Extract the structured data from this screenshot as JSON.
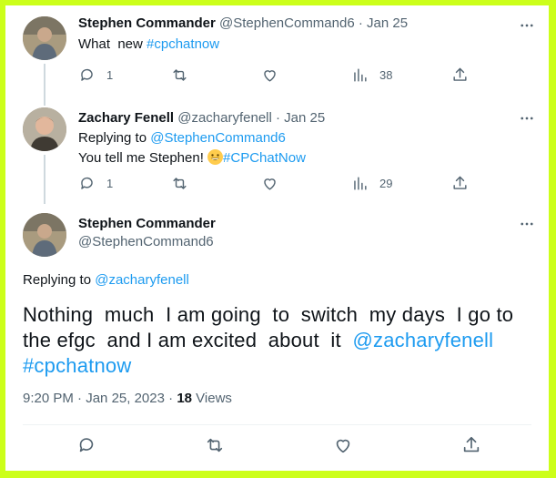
{
  "tweets": [
    {
      "display_name": "Stephen Commander",
      "handle": "@StephenCommand6",
      "date": "Jan 25",
      "text_plain": "What  new ",
      "hashtag": "#cpchatnow",
      "replies": "1",
      "views": "38"
    },
    {
      "display_name": "Zachary Fenell",
      "handle": "@zacharyfenell",
      "date": "Jan 25",
      "replying_label": "Replying to ",
      "replying_to": "@StephenCommand6",
      "text_plain": "You tell me Stephen! ",
      "hashtag": "#CPChatNow",
      "replies": "1",
      "views": "29"
    }
  ],
  "main_tweet": {
    "display_name": "Stephen Commander",
    "handle": "@StephenCommand6",
    "replying_label": "Replying to ",
    "replying_to": "@zacharyfenell",
    "text_plain": "Nothing  much  I am going  to  switch  my days  I go to the efgc  and I am excited  about  it  ",
    "mention": "@zacharyfenell",
    "hashtag": "#cpchatnow",
    "time": "9:20 PM",
    "date": "Jan 25, 2023",
    "views_count": "18",
    "views_label": " Views"
  },
  "separator": " · ",
  "icons": {
    "more": "more-icon",
    "reply": "reply-icon",
    "retweet": "retweet-icon",
    "like": "heart-icon",
    "views": "views-chart-icon",
    "share": "share-icon",
    "emoji": "grinning-emoji-icon"
  },
  "colors": {
    "link": "#1d9bf0",
    "muted": "#536471",
    "border": "#ccff1a"
  }
}
